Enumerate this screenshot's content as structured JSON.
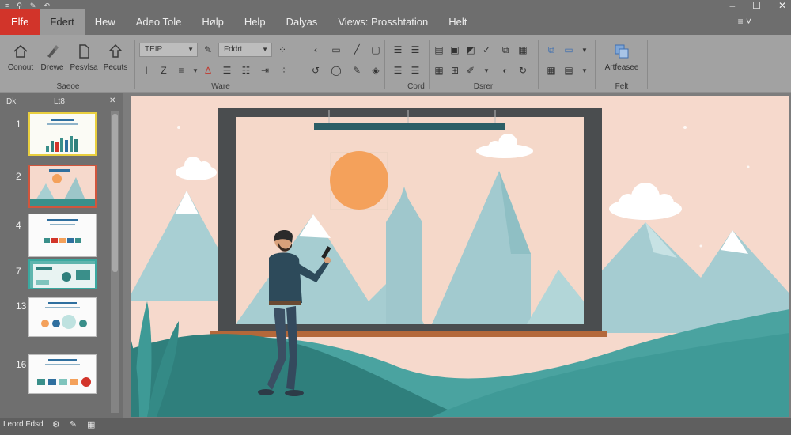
{
  "window": {
    "quick_access": [
      "≡",
      "⚲",
      "✎",
      "↶"
    ],
    "controls": [
      "–",
      "☐",
      "✕"
    ],
    "ribbon_toggle": "≡ ˅"
  },
  "tabs": [
    {
      "label": "Elfe"
    },
    {
      "label": "Fdert"
    },
    {
      "label": "Hew"
    },
    {
      "label": "Adeo Tole"
    },
    {
      "label": "Hølp"
    },
    {
      "label": "Help"
    },
    {
      "label": "Dalyas"
    },
    {
      "label": "Views: Prosshtation"
    },
    {
      "label": "Helt"
    }
  ],
  "ribbon": {
    "group1": {
      "label": "Saeoe",
      "buttons": [
        "Conout",
        "Drewe",
        "Pesvlsa",
        "Pecuts"
      ]
    },
    "group2": {
      "label": "Ware",
      "font_name": "TEIP",
      "font_size": "Fddrt",
      "format_icons": [
        "I",
        "Z",
        "≡",
        "∆"
      ]
    },
    "group3": {
      "label": "Cord"
    },
    "group4": {
      "label": "Dsrer"
    },
    "group5": {
      "label": "Felt",
      "button": "Artfeasee"
    }
  },
  "panel": {
    "header_left": "Dk",
    "header_center": "Lt8",
    "collapse": "✕",
    "slides": [
      {
        "number": "1"
      },
      {
        "number": "2"
      },
      {
        "number": "4"
      },
      {
        "number": "7"
      },
      {
        "number": "13"
      },
      {
        "number": "16"
      }
    ]
  },
  "status": {
    "left": "Leord Fdsd"
  },
  "colors": {
    "file_tab": "#d2342a",
    "canvas_bg": "#f6d9cc",
    "teal_dark": "#2f7f7c",
    "teal_mid": "#4aa3a0",
    "sun": "#f4a15b",
    "mountain": "#a7cfd2"
  }
}
